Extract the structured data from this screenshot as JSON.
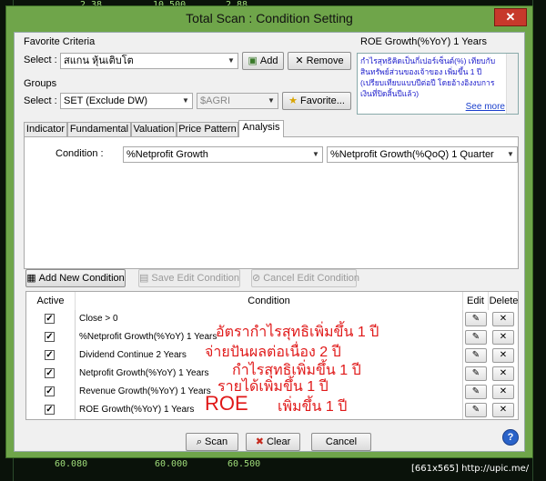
{
  "window": {
    "title": "Total Scan : Condition Setting"
  },
  "favorite": {
    "group_label": "Favorite Criteria",
    "select_label": "Select :",
    "value": "สแกน หุ้นเติบโต",
    "add_label": "Add",
    "remove_label": "Remove"
  },
  "groups": {
    "group_label": "Groups",
    "select_label": "Select :",
    "value": "SET (Exclude DW)",
    "secondary_value": "$AGRI",
    "favorite_label": "Favorite..."
  },
  "description": {
    "title": "ROE Growth(%YoY) 1 Years",
    "text": "กำไรสุทธิคิดเป็นกี่เปอร์เซ็นต์(%) เทียบกับสินทรัพย์ส่วนของเจ้าของ เพิ่มขึ้น 1 ปี (เปรียบเทียบแบบปีต่อปี โดยอ้างอิงงบการเงินที่ปิดสิ้นปีแล้ว)",
    "see_more": "See more"
  },
  "tabs": [
    "Indicator",
    "Fundamental",
    "Valuation",
    "Price Pattern",
    "Analysis"
  ],
  "condition": {
    "label": "Condition :",
    "value1": "%Netprofit Growth",
    "value2": "%Netprofit Growth(%QoQ) 1 Quarter"
  },
  "actions": {
    "add": "Add New Condition",
    "save": "Save Edit Condition",
    "cancel": "Cancel Edit Condition"
  },
  "grid": {
    "headers": {
      "active": "Active",
      "condition": "Condition",
      "edit": "Edit",
      "delete": "Delete"
    },
    "rows": [
      {
        "active": true,
        "condition": "Close > 0"
      },
      {
        "active": true,
        "condition": "%Netprofit Growth(%YoY) 1 Years"
      },
      {
        "active": true,
        "condition": "Dividend Continue 2 Years"
      },
      {
        "active": true,
        "condition": "Netprofit Growth(%YoY) 1 Years"
      },
      {
        "active": true,
        "condition": "Revenue Growth(%YoY) 1 Years"
      },
      {
        "active": true,
        "condition": "ROE Growth(%YoY) 1 Years"
      }
    ]
  },
  "annotations": [
    "อัตรากำไรสุทธิเพิ่มขึ้น 1 ปี",
    "จ่ายปันผลต่อเนื่อง 2 ปี",
    "กำไรสุทธิเพิ่มขึ้น 1 ปี",
    "รายได้เพิ่มขึ้น 1 ปี",
    "ROE",
    "เพิ่มขึ้น 1 ปี"
  ],
  "buttons": {
    "scan": "Scan",
    "clear": "Clear",
    "cancel": "Cancel"
  },
  "background": {
    "numbers": [
      "2.38",
      "10.500",
      "2.88",
      "60.080",
      "60.000",
      "60.500"
    ]
  },
  "footer": "[661x565] http://upic.me/",
  "colors": {
    "title_bg": "#6fa54a",
    "annotation": "#e01919",
    "link": "#1a3fcc"
  }
}
